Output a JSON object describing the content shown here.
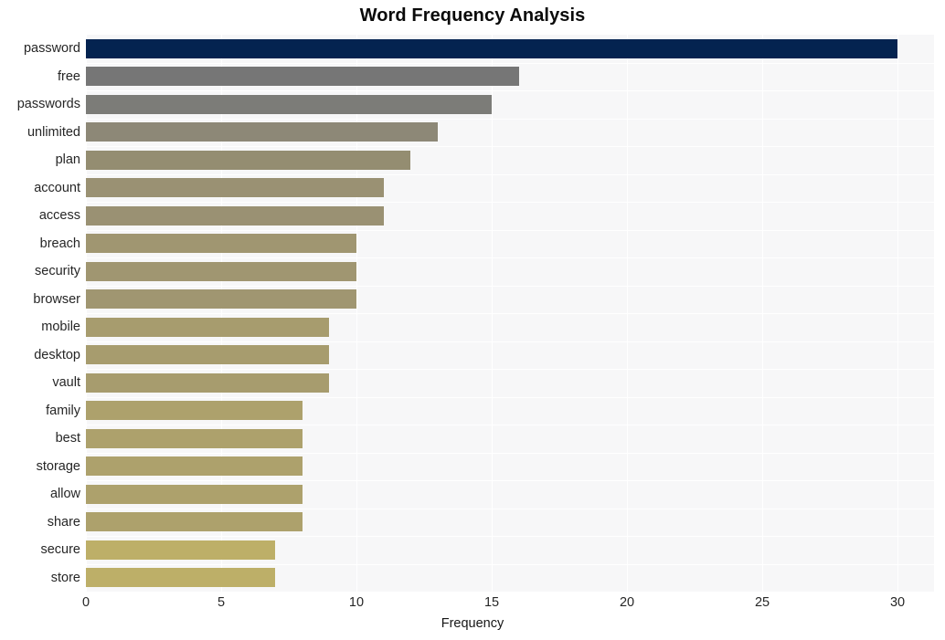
{
  "chart_data": {
    "type": "bar",
    "orientation": "horizontal",
    "title": "Word Frequency Analysis",
    "xlabel": "Frequency",
    "ylabel": "",
    "categories": [
      "password",
      "free",
      "passwords",
      "unlimited",
      "plan",
      "account",
      "access",
      "breach",
      "security",
      "browser",
      "mobile",
      "desktop",
      "vault",
      "family",
      "best",
      "storage",
      "allow",
      "share",
      "secure",
      "store"
    ],
    "values": [
      30,
      16,
      15,
      13,
      12,
      11,
      11,
      10,
      10,
      10,
      9,
      9,
      9,
      8,
      8,
      8,
      8,
      8,
      7,
      7
    ],
    "bar_colors": [
      "#042350",
      "#767676",
      "#7c7c78",
      "#8d8877",
      "#948d71",
      "#9a9173",
      "#9a9173",
      "#a09671",
      "#a09671",
      "#a09671",
      "#a79c6e",
      "#a79c6e",
      "#a79c6e",
      "#ada16c",
      "#ada16c",
      "#ada16c",
      "#ada16c",
      "#ada16c",
      "#bdaf68",
      "#bdaf68"
    ],
    "xticks": [
      0,
      5,
      10,
      15,
      20,
      25,
      30
    ],
    "xtick_labels": [
      "0",
      "5",
      "10",
      "15",
      "20",
      "25",
      "30"
    ],
    "xlim": [
      0,
      31.35
    ],
    "grid": true,
    "grid_color": "#ffffff",
    "plot_background": "#f7f7f8",
    "figure_background": "#ffffff",
    "legend": null
  }
}
